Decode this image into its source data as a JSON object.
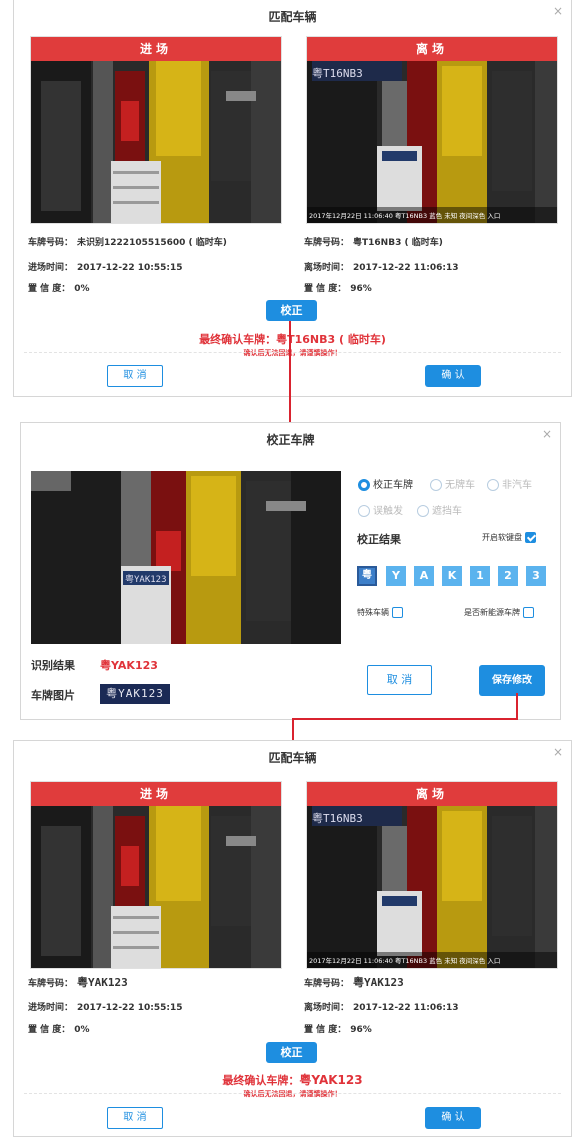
{
  "dialog1": {
    "title": "匹配车辆",
    "close": "×",
    "entry": {
      "header": "进场",
      "plate_label": "车牌号码：",
      "plate_value": "未识别1222105515600 ( 临时车)",
      "time_label": "进场时间：",
      "time_value": "2017-12-22 10:55:15",
      "confidence_label": "置 信 度：",
      "confidence_value": "0%"
    },
    "exit": {
      "header": "离场",
      "plate_label": "车牌号码：",
      "plate_value": "粤T16NB3 ( 临时车)",
      "time_label": "离场时间：",
      "time_value": "2017-12-22 11:06:13",
      "confidence_label": "置 信 度：",
      "confidence_value": "96%",
      "overlay": "2017年12月22日 11:06:40 粤T16NB3 蓝色 未知 夜间深色 入口",
      "plate_in_photo": "粤T16NB3"
    },
    "correct_button": "校正",
    "final_label": "最终确认车牌：",
    "final_value": "粤T16NB3 ( 临时车)",
    "warning": "确认后无法回退，请谨慎操作！",
    "cancel": "取 消",
    "confirm": "确 认"
  },
  "dialog2": {
    "title": "校正车牌",
    "close": "×",
    "photo_plate": "粤YAK123",
    "options": [
      {
        "label": "校正车牌",
        "checked": true,
        "disabled": false
      },
      {
        "label": "无牌车",
        "checked": false,
        "disabled": true
      },
      {
        "label": "非汽车",
        "checked": false,
        "disabled": true
      },
      {
        "label": "误触发",
        "checked": false,
        "disabled": true
      },
      {
        "label": "遮挡车",
        "checked": false,
        "disabled": true
      }
    ],
    "result_label": "校正结果",
    "soft_keyboard_label": "开启软键盘",
    "plate_chars": [
      "粤",
      "Y",
      "A",
      "K",
      "1",
      "2",
      "3"
    ],
    "special_vehicle_label": "特殊车辆",
    "new_energy_label": "是否新能源车牌",
    "recognition_label": "识别结果",
    "recognition_value": "粤YAK123",
    "plate_image_label": "车牌图片",
    "cancel": "取 消",
    "save": "保存修改"
  },
  "dialog3": {
    "title": "匹配车辆",
    "close": "×",
    "entry": {
      "header": "进场",
      "plate_label": "车牌号码：",
      "plate_value": "粤YAK123",
      "time_label": "进场时间：",
      "time_value": "2017-12-22 10:55:15",
      "confidence_label": "置 信 度：",
      "confidence_value": "0%"
    },
    "exit": {
      "header": "离场",
      "plate_label": "车牌号码：",
      "plate_value": "粤YAK123",
      "time_label": "离场时间：",
      "time_value": "2017-12-22 11:06:13",
      "confidence_label": "置 信 度：",
      "confidence_value": "96%",
      "overlay": "2017年12月22日 11:06:40 粤T16NB3 蓝色 未知 夜间深色 入口",
      "plate_in_photo": "粤T16NB3"
    },
    "correct_button": "校正",
    "final_label": "最终确认车牌：",
    "final_value": "粤YAK123",
    "warning": "确认后无法回退，请谨慎操作！",
    "cancel": "取 消",
    "confirm": "确 认"
  }
}
